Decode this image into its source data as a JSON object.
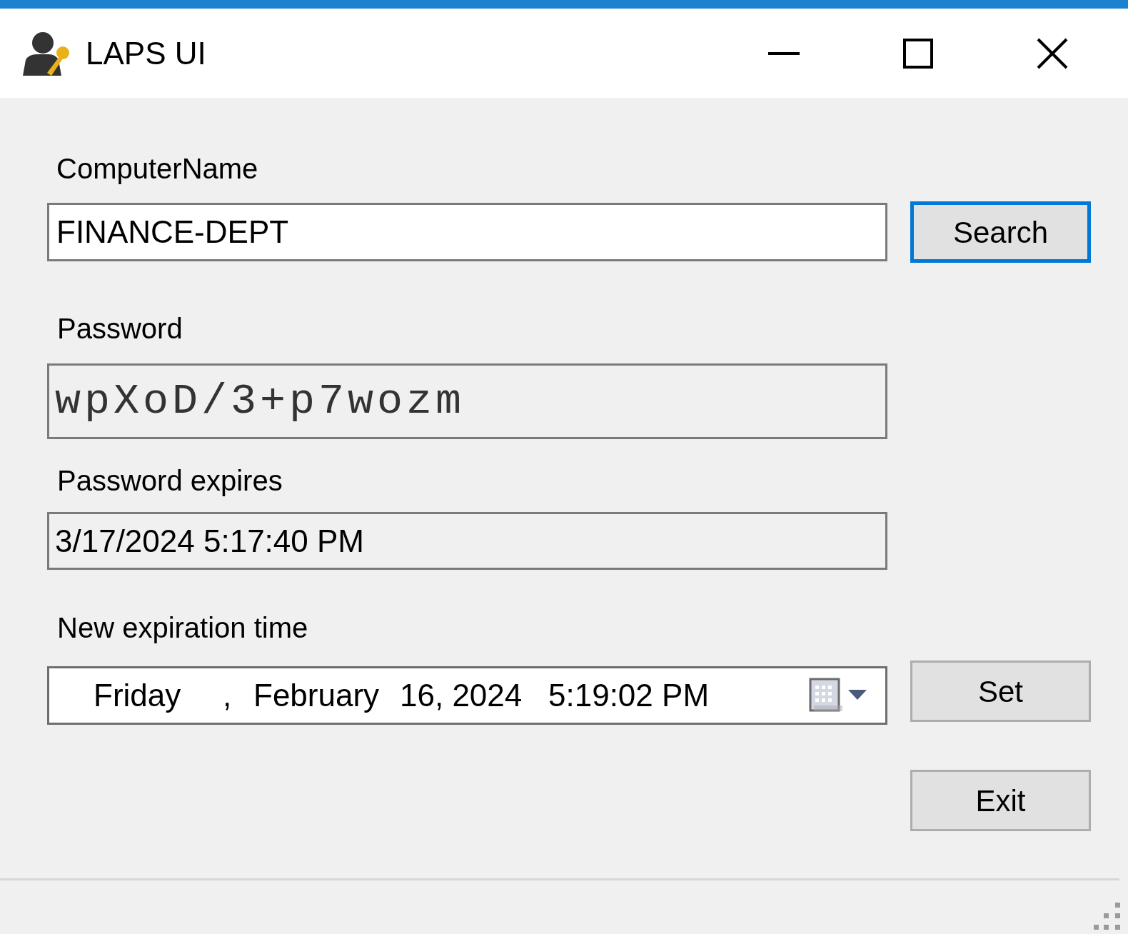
{
  "window": {
    "title": "LAPS UI"
  },
  "computer_name": {
    "label": "ComputerName",
    "value": "FINANCE-DEPT"
  },
  "search_button": {
    "label": "Search",
    "focused": true
  },
  "password": {
    "label": "Password",
    "value": "wpXoD/3+p7wozm"
  },
  "password_expires": {
    "label": "Password expires",
    "value": "3/17/2024 5:17:40 PM"
  },
  "new_expiration": {
    "label": "New expiration time",
    "parts": [
      "Friday",
      ",",
      "February",
      "16, 2024",
      "5:19:02 PM"
    ]
  },
  "buttons": [
    {
      "label": "Set"
    },
    {
      "label": "Exit"
    }
  ]
}
